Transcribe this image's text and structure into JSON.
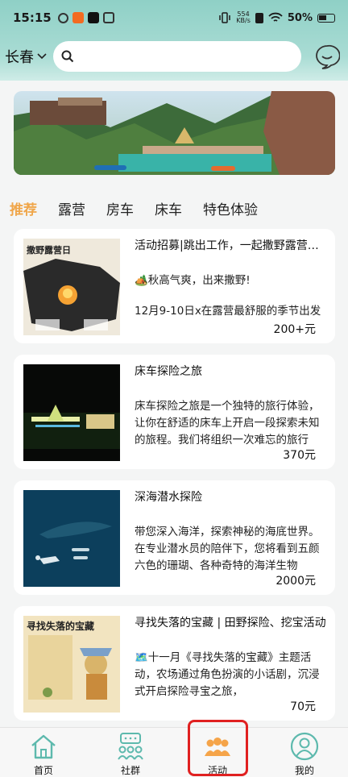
{
  "status_bar": {
    "time": "15:15",
    "net_speed_value": "554",
    "net_speed_unit": "KB/s",
    "battery": "50%"
  },
  "header": {
    "city": "长春",
    "search_placeholder": ""
  },
  "tabs": [
    "推荐",
    "露营",
    "房车",
    "床车",
    "特色体验"
  ],
  "activities": [
    {
      "title": "活动招募|跳出工作，一起撒野露营啦！",
      "desc": "🏕️秋高气爽，出来撒野!",
      "desc2": "12月9-10日x在露营最舒服的季节出发",
      "price": "200+元"
    },
    {
      "title": "床车探险之旅",
      "desc": "床车探险之旅是一个独特的旅行体验，让你在舒适的床车上开启一段探索未知的旅程。我们将组织一次难忘的旅行",
      "price": "370元"
    },
    {
      "title": "深海潜水探险",
      "desc": "带您深入海洋，探索神秘的海底世界。在专业潜水员的陪伴下，您将看到五颜六色的珊瑚、各种奇特的海洋生物",
      "price": "2000元"
    },
    {
      "title": "寻找失落的宝藏 | 田野探险、挖宝活动",
      "desc": "🗺️十一月《寻找失落的宝藏》主题活动，农场通过角色扮演的小话剧，沉浸式开启探险寻宝之旅，",
      "price": "70元"
    }
  ],
  "thumb_text": {
    "camp_title": "撒野露营日",
    "treasure_title": "寻找失落的宝藏"
  },
  "nav": [
    "首页",
    "社群",
    "活动",
    "我的"
  ],
  "colors": {
    "accent": "#f0a64a",
    "teal": "#5db9ad",
    "highlight": "#e02020"
  }
}
